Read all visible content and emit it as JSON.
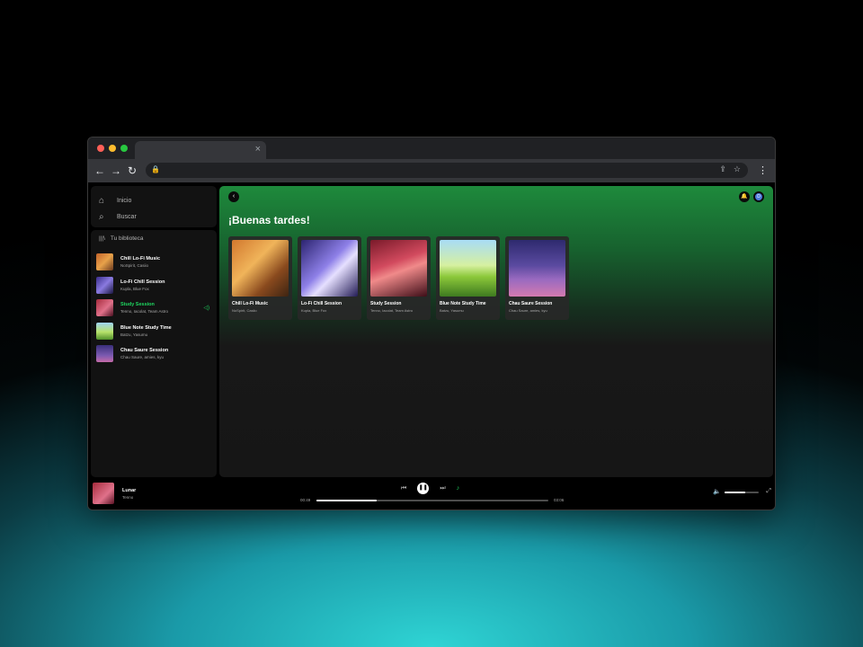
{
  "browser": {
    "tab_close": "×",
    "nav": {
      "back": "←",
      "forward": "→",
      "reload": "↻"
    },
    "icons": {
      "share": "share-icon",
      "star": "star-icon",
      "menu": "more-vert-icon"
    }
  },
  "sidebar": {
    "nav": [
      {
        "label": "Inicio",
        "icon": "home-icon"
      },
      {
        "label": "Buscar",
        "icon": "search-icon"
      }
    ],
    "library_label": "Tu biblioteca",
    "items": [
      {
        "title": "Chill Lo-Fi Music",
        "subtitle": "NoSpirit, Casiio",
        "active": false
      },
      {
        "title": "Lo-Fi Chill Session",
        "subtitle": "Kupla, Blue Fox",
        "active": false
      },
      {
        "title": "Study Session",
        "subtitle": "Tenno, Iacolat, Team Astro",
        "active": true
      },
      {
        "title": "Blue Note Study Time",
        "subtitle": "Batzu, Yasumu",
        "active": false
      },
      {
        "title": "Chau Saure Session",
        "subtitle": "Chau Saure, amies, kyu",
        "active": false
      }
    ]
  },
  "main": {
    "greeting": "¡Buenas tardes!",
    "avatar_initial": "D",
    "cards": [
      {
        "title": "Chill Lo-Fi Music",
        "subtitle": "NoSpirit, Casiio"
      },
      {
        "title": "Lo-Fi Chill Session",
        "subtitle": "Kupla, Blue Fox"
      },
      {
        "title": "Study Session",
        "subtitle": "Tenno, Iacolat, Team Astro"
      },
      {
        "title": "Blue Note Study Time",
        "subtitle": "Batzu, Yasumu"
      },
      {
        "title": "Chau Saure Session",
        "subtitle": "Chau Saure, amies, kyu"
      }
    ]
  },
  "player": {
    "title": "Lunar",
    "artist": "Tenno",
    "elapsed": "00:49",
    "duration": "03:06",
    "progress": 0.26,
    "volume": 0.6
  },
  "colors": {
    "accent": "#1ed760",
    "main_gradient_top": "#1e8a3c"
  }
}
